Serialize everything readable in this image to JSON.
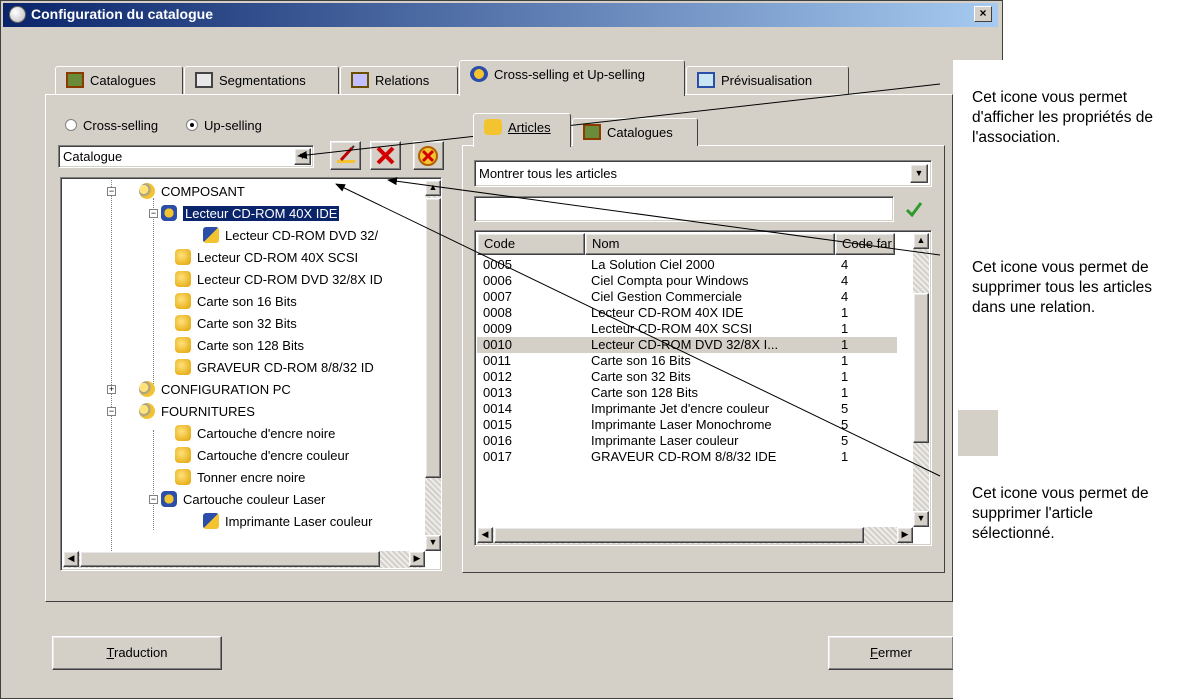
{
  "window": {
    "title": "Configuration du catalogue",
    "close_label": "×"
  },
  "tabs": [
    {
      "label": "Catalogues",
      "icon": "catalog-icon"
    },
    {
      "label": "Segmentations",
      "icon": "segmentation-icon"
    },
    {
      "label": "Relations",
      "icon": "relations-icon"
    },
    {
      "label": "Cross-selling et Up-selling",
      "icon": "cross-selling-icon",
      "active": true
    },
    {
      "label": "Prévisualisation",
      "icon": "preview-icon"
    }
  ],
  "mode": {
    "cross_label": "Cross-selling",
    "up_label": "Up-selling",
    "selected": "Up-selling"
  },
  "left": {
    "catalogue_value": "Catalogue"
  },
  "tree": [
    {
      "label": "COMPOSANT",
      "type": "group",
      "expander": "−"
    },
    {
      "label": "Lecteur CD-ROM 40X IDE",
      "type": "cross",
      "selected": true,
      "expander": "−"
    },
    {
      "label": "Lecteur CD-ROM DVD 32/",
      "type": "arrow"
    },
    {
      "label": "Lecteur CD-ROM 40X SCSI",
      "type": "item"
    },
    {
      "label": "Lecteur CD-ROM DVD 32/8X ID",
      "type": "item"
    },
    {
      "label": "Carte son 16 Bits",
      "type": "item"
    },
    {
      "label": "Carte son 32 Bits",
      "type": "item"
    },
    {
      "label": "Carte son 128 Bits",
      "type": "item"
    },
    {
      "label": "GRAVEUR CD-ROM 8/8/32 ID",
      "type": "item"
    },
    {
      "label": "CONFIGURATION PC",
      "type": "group",
      "expander": "+"
    },
    {
      "label": "FOURNITURES",
      "type": "group",
      "expander": "−"
    },
    {
      "label": "Cartouche d'encre noire",
      "type": "item"
    },
    {
      "label": "Cartouche d'encre couleur",
      "type": "item"
    },
    {
      "label": "Tonner encre noire",
      "type": "item"
    },
    {
      "label": "Cartouche couleur Laser",
      "type": "cross",
      "expander": "−"
    },
    {
      "label": "Imprimante Laser couleur",
      "type": "arrow"
    }
  ],
  "right": {
    "subtabs": [
      {
        "label": "Articles",
        "active": true
      },
      {
        "label": "Catalogues"
      }
    ],
    "filter_value": "Montrer tous les articles",
    "search_value": "",
    "columns": [
      "Code",
      "Nom",
      "Code far"
    ],
    "rows": [
      [
        "0005",
        "La Solution Ciel 2000",
        "4"
      ],
      [
        "0006",
        "Ciel Compta pour Windows",
        "4"
      ],
      [
        "0007",
        "Ciel Gestion Commerciale",
        "4"
      ],
      [
        "0008",
        "Lecteur CD-ROM 40X IDE",
        "1"
      ],
      [
        "0009",
        "Lecteur CD-ROM 40X SCSI",
        "1"
      ],
      [
        "0010",
        "Lecteur CD-ROM DVD 32/8X I...",
        "1"
      ],
      [
        "0011",
        "Carte son 16 Bits",
        "1"
      ],
      [
        "0012",
        "Carte son 32 Bits",
        "1"
      ],
      [
        "0013",
        "Carte son 128 Bits",
        "1"
      ],
      [
        "0014",
        "Imprimante Jet d'encre couleur",
        "5"
      ],
      [
        "0015",
        "Imprimante Laser Monochrome",
        "5"
      ],
      [
        "0016",
        "Imprimante Laser couleur",
        "5"
      ],
      [
        "0017",
        "GRAVEUR CD-ROM 8/8/32 IDE",
        "1"
      ]
    ],
    "highlighted_row": 5
  },
  "buttons": {
    "traduction": {
      "underline": "T",
      "rest": "raduction"
    },
    "fermer": {
      "underline": "F",
      "rest": "ermer"
    }
  },
  "annotations": [
    "Cet icone vous permet d'afficher les propriétés de l'association.",
    "Cet icone vous permet de supprimer tous les articles dans une relation.",
    "Cet icone vous permet de supprimer l'article sélectionné."
  ],
  "colors": {
    "title_start": "#0a246a",
    "title_end": "#a6caf0",
    "face": "#d4d0c8",
    "selection": "#0a246a",
    "delete_red": "#d40000",
    "check_green": "#2e9a2e"
  }
}
